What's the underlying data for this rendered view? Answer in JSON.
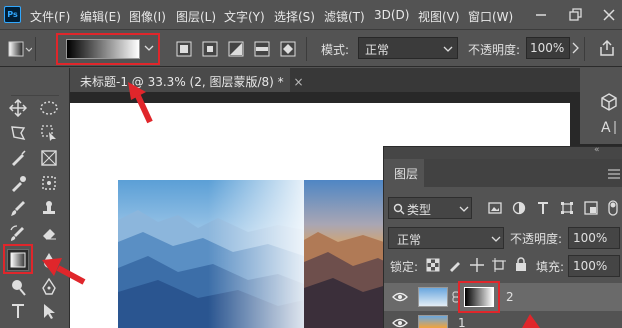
{
  "app": {
    "logo": "Ps"
  },
  "menu": [
    "文件(F)",
    "编辑(E)",
    "图像(I)",
    "图层(L)",
    "文字(Y)",
    "选择(S)",
    "滤镜(T)",
    "3D(D)",
    "视图(V)",
    "窗口(W)"
  ],
  "options": {
    "mode_label": "模式:",
    "mode_value": "正常",
    "opacity_label": "不透明度:",
    "opacity_value": "100%"
  },
  "document": {
    "tab_title": "未标题-1 @ 33.3% (2, 图层蒙版/8) *",
    "close_glyph": "×"
  },
  "layers_panel": {
    "title": "图层",
    "filter_kind": "类型",
    "blend_mode": "正常",
    "opacity_label": "不透明度:",
    "opacity_value": "100%",
    "lock_label": "锁定:",
    "fill_label": "填充:",
    "fill_value": "100%",
    "layers": [
      {
        "name": "2",
        "selected": true
      },
      {
        "name": "1",
        "selected": false
      }
    ]
  },
  "colors": {
    "highlight": "#e0262b",
    "panel": "#535353",
    "canvas": "#ffffff",
    "dark": "#282828"
  }
}
